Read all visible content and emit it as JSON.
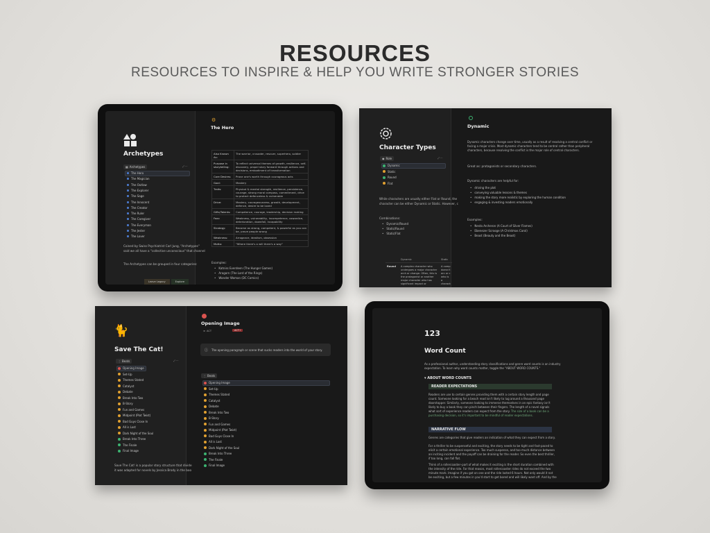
{
  "header": {
    "title": "RESOURCES",
    "subtitle": "RESOURCES TO INSPIRE & HELP YOU WRITE STRONGER STORIES"
  },
  "archetypes": {
    "title": "Archetypes",
    "filter_tag": "Archetypes",
    "items": [
      "The Hero",
      "The Magician",
      "The Outlaw",
      "The Explorer",
      "The Sage",
      "The Innocent",
      "The Creator",
      "The Ruler",
      "The Caregiver",
      "The Everyman",
      "The Jester",
      "The Lover"
    ],
    "intro_1": "Coined by Swiss Psychiatrist Carl Jung, \"Archetypes\"",
    "intro_2": "said we all have a \"collective unconscious\" that channel",
    "intro_3": "The Archetypes can be grouped in four categories:",
    "footer_tabs": [
      "Leave Legacy",
      "Explore"
    ],
    "detail_title": "The Hero",
    "rows": [
      {
        "k": "Also Known As:",
        "v": "The warrior, crusader, rescuer, superhero, soldier"
      },
      {
        "k": "Purpose in storytelling:",
        "v": "To reflect universal themes of growth, resilience, self-discovery, propel story forward through actions and decisions, embodiment of transformation"
      },
      {
        "k": "Core Desires:",
        "v": "Prove one's worth through courageous acts"
      },
      {
        "k": "Goal:",
        "v": "Mastery"
      },
      {
        "k": "Traits:",
        "v": "Physical & mental strength, resilience, persistence, courage, strong moral compass, commitment, drive to protect defenceless & vulnerable"
      },
      {
        "k": "Drive:",
        "v": "Mastery, courageousness, growth, development, defence, desire to be loved"
      },
      {
        "k": "Gifts/Talents:",
        "v": "Competence, courage, leadership, decision making"
      },
      {
        "k": "Fear:",
        "v": "Weakness, vulnerability, incompetence, cowardice, deterioration, downfall, incapability"
      },
      {
        "k": "Strategy:",
        "v": "Become as strong, competent, & powerful as you can be, prove people wrong"
      },
      {
        "k": "Weakness:",
        "v": "Arrogance, idealism, obsession"
      },
      {
        "k": "Motto:",
        "v": "\"Where there's a will there's a way\""
      }
    ],
    "examples_label": "Examples:",
    "examples": [
      "Katniss Everdeen (The Hunger Games)",
      "Aragorn (The Lord of the Rings)",
      "Wonder Woman (DC Comics)"
    ]
  },
  "character_types": {
    "title": "Character Types",
    "filter_tag": "Role",
    "items": [
      "Dynamic",
      "Static",
      "Round",
      "Flat"
    ],
    "intro_1": "While characters are usually either Flat or Round, the",
    "intro_2": "character can be either Dynamic or Static. However, c",
    "combinations_label": "Combinations:",
    "combinations": [
      "Dynamic/Round",
      "Static/Round",
      "Static/Flat"
    ],
    "table_head": [
      "Dynamic",
      "Static"
    ],
    "table_row_label": "Round",
    "table_cell_1": "A complex character who undergoes a major character arch or change. Often, this is the protagonist or another major character who has significant impact or",
    "table_cell_2": "A comp doesn't arc or c who is a characte undergo",
    "detail_title": "Dynamic",
    "detail_p1": "Dynamic characters change over time, usually as a result of resolving a central conflict or facing a major crisis. Most dynamic characters tend to be central rather than peripheral characters, because resolving the conflict is the major role of central characters.",
    "great_as": "Great as: protagonists or secondary characters.",
    "helpful_label": "Dynamic characters are helpful for:",
    "helpful": [
      "driving the plot",
      "conveying valuable lessons & themes",
      "making the story more realistic by exploring the human condition",
      "engaging & investing readers emotionally"
    ],
    "examples_label": "Examples:",
    "examples": [
      "Nesta Archeron (A Court of Silver Flames)",
      "Ebenezer Scrooge (A Christmas Carol)",
      "Beast (Beauty and the Beast)"
    ]
  },
  "save_the_cat": {
    "title": "Save The Cat!",
    "filter_tag": "Beats",
    "items": [
      "Opening Image",
      "Set-Up",
      "Themes Stated",
      "Catalyst",
      "Debate",
      "Break Into Two",
      "B-Story",
      "Fun and Games",
      "Midpoint (Plot Twist)",
      "Bad Guys Close In",
      "All is Lost",
      "Dark Night of the Soul",
      "Break Into Three",
      "The Finale",
      "Final Image"
    ],
    "intro_1": "Save The Cat! is a popular story structure that divide",
    "intro_2": "it was adapted for novels by Jessica Brody in the boo",
    "detail_title": "Opening Image",
    "act_label": "ACT",
    "act_value": "ACT I",
    "callout": "The opening paragraph or scene that sucks readers into the world of your story.",
    "detail_tag": "Beats"
  },
  "word_count": {
    "number": "123",
    "title": "Word Count",
    "intro": "As a professional author, understanding story classifications and genre word counts is an industry expectation. To learn why word counts matter, toggle the \"ABOUT WORD COUNTS.\"",
    "toggle": "ABOUT WORD COUNTS",
    "section1": "READER EXPECTATIONS",
    "p1": "Readers are use to certain genres providing them with a certain story length and page count. Someone looking for a beach read isn't likely to lug around a thousand page doorstopper. Similarly, someone looking to immerse themselves in an epic fantasy isn't likely to buy a book they can pinch between their fingers. The length of a novel signals what sort of experience readers can expect from the story.",
    "p1_green": "The size of a book can be a purchasing decision, so it's important to be mindful of reader expectations.",
    "section2": "NARRATIVE FLOW",
    "p2": "Genres are categories that give readers an indication of what they can expect from a story.",
    "p3": "For a thriller to be suspenseful and exciting, the story needs to be tight and fast-paced to elicit a certain emotional experience. Too much suspense, and too much distance between an inciting incident and the payoff can be draining for the reader. So even the best thriller, if too long, can fall flat.",
    "p4": "Think of a rollercoaster–part of what makes it exciting is the short duration combined with the intensity of the ride. For that reason, most rollercoaster rides do not exceed the two minute mark. Imagine if you got on one and the ride lasted 6 hours. Not only would it not be exciting, but a few minutes in you'd start to get bored and will likely want off. And by the time it's done, you'd be so bored and uninterested you'd likely never get on one again."
  },
  "colors": {
    "beat_dots": [
      "#d9534f",
      "#e0a030",
      "#e0a030",
      "#e0a030",
      "#e0a030",
      "#e0a030",
      "#e0a030",
      "#e0a030",
      "#e0a030",
      "#e0a030",
      "#e0a030",
      "#e0a030",
      "#3cb371",
      "#3cb371",
      "#3cb371"
    ],
    "char_dots": [
      "#3cb371",
      "#e0a030",
      "#3cb371",
      "#e0a030"
    ]
  }
}
